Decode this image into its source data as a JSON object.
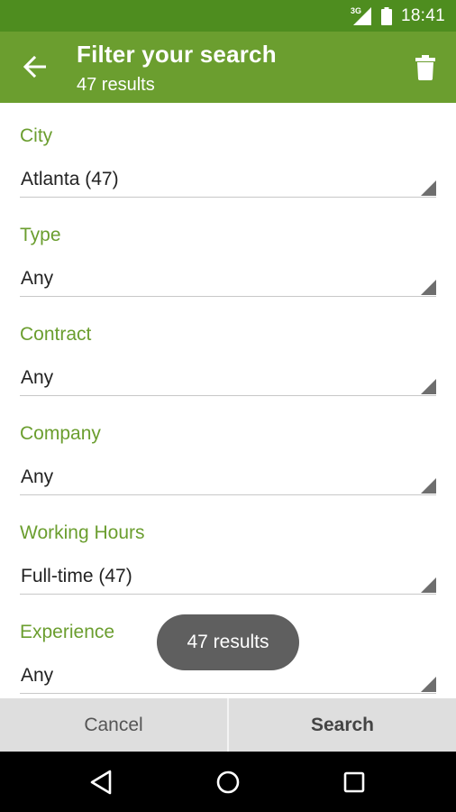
{
  "status_bar": {
    "network": "3G",
    "time": "18:41"
  },
  "app_bar": {
    "title": "Filter your search",
    "subtitle": "47 results",
    "back_icon": "arrow-back-icon",
    "delete_icon": "trash-icon"
  },
  "fields": [
    {
      "label": "City",
      "value": "Atlanta (47)"
    },
    {
      "label": "Type",
      "value": "Any"
    },
    {
      "label": "Contract",
      "value": "Any"
    },
    {
      "label": "Company",
      "value": "Any"
    },
    {
      "label": "Working Hours",
      "value": "Full-time (47)"
    },
    {
      "label": "Experience",
      "value": "Any"
    }
  ],
  "toast": {
    "text": "47 results"
  },
  "actions": {
    "cancel_label": "Cancel",
    "search_label": "Search"
  },
  "nav_bar": {
    "back_icon": "triangle-back-icon",
    "home_icon": "circle-home-icon",
    "recents_icon": "square-recents-icon"
  },
  "colors": {
    "status_bar": "#4e8d1f",
    "app_bar": "#6b9e2f",
    "accent_label": "#6b9e2f",
    "action_bar": "#dedede",
    "toast": "#5f5f5f"
  }
}
